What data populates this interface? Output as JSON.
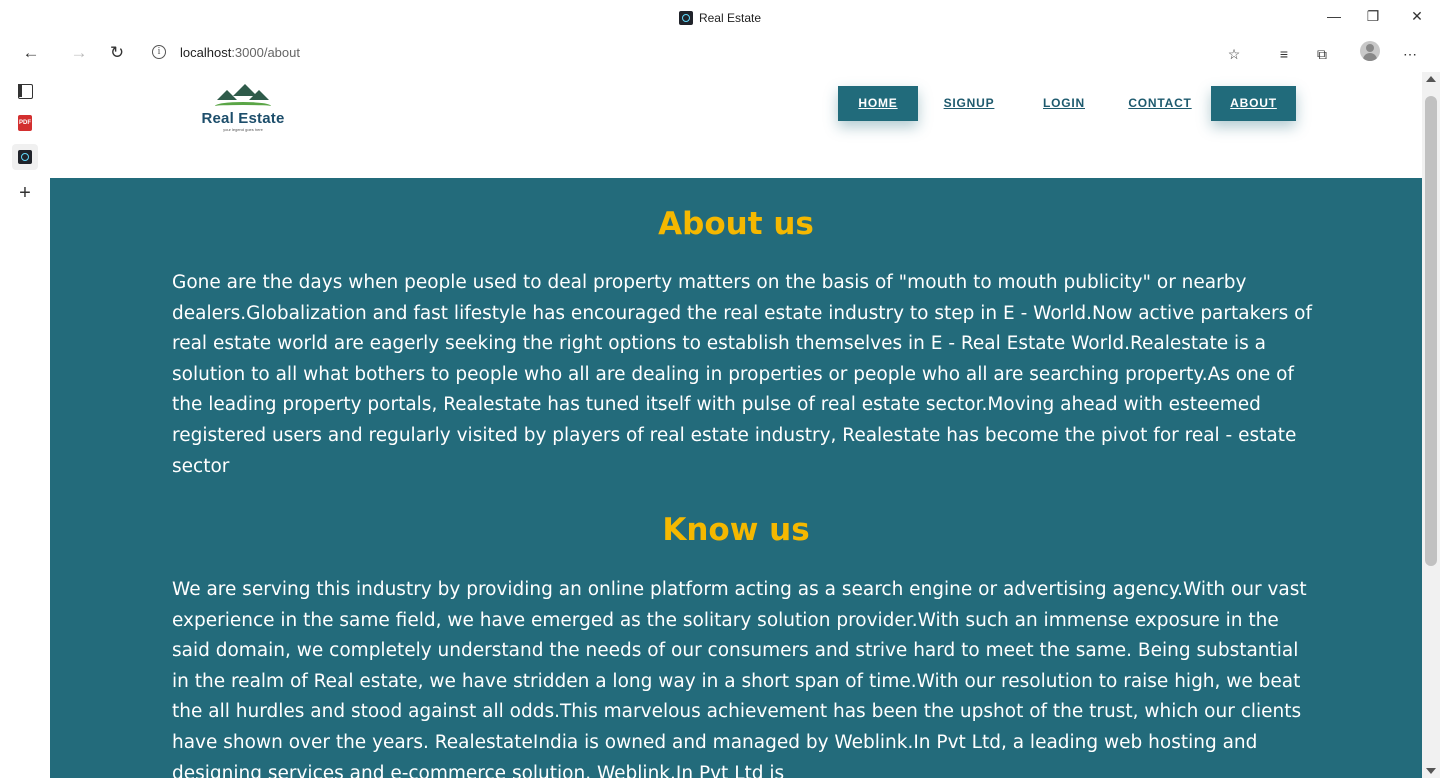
{
  "browser": {
    "window_title": "Real Estate",
    "url_host": "localhost",
    "url_path": ":3000/about",
    "window_controls": [
      "—",
      "❐",
      "✕"
    ]
  },
  "header": {
    "logo_text": "Real Estate",
    "logo_tagline": "your legend goes here",
    "nav": [
      {
        "label": "HOME"
      },
      {
        "label": "SIGNUP"
      },
      {
        "label": "LOGIN"
      },
      {
        "label": "CONTACT"
      },
      {
        "label": "ABOUT"
      }
    ]
  },
  "about": {
    "title": "About us",
    "text": "Gone are the days when people used to deal property matters on the basis of \"mouth to mouth publicity\" or nearby dealers.Globalization and fast lifestyle has encouraged the real estate industry to step in E - World.Now active partakers of real estate world are eagerly seeking the right options to establish themselves in E - Real Estate World.Realestate is a solution to all what bothers to people who all are dealing in properties or people who all are searching property.As one of the leading property portals, Realestate has tuned itself with pulse of real estate sector.Moving ahead with esteemed registered users and regularly visited by players of real estate industry, Realestate has become the pivot for real - estate sector"
  },
  "know": {
    "title": "Know us",
    "text": "We are serving this industry by providing an online platform acting as a search engine or advertising agency.With our vast experience in the same field, we have emerged as the solitary solution provider.With such an immense exposure in the said domain, we completely understand the needs of our consumers and strive hard to meet the same. Being substantial in the realm of Real estate, we have stridden a long way in a short span of time.With our resolution to raise high, we beat the all hurdles and stood against all odds.This marvelous achievement has been the upshot of the trust, which our clients have shown over the years. RealestateIndia is owned and managed by Weblink.In Pvt Ltd, a leading web hosting and designing services and e-commerce solution. Weblink.In Pvt Ltd is"
  },
  "colors": {
    "teal": "#236b7b",
    "gold": "#f5b800"
  }
}
